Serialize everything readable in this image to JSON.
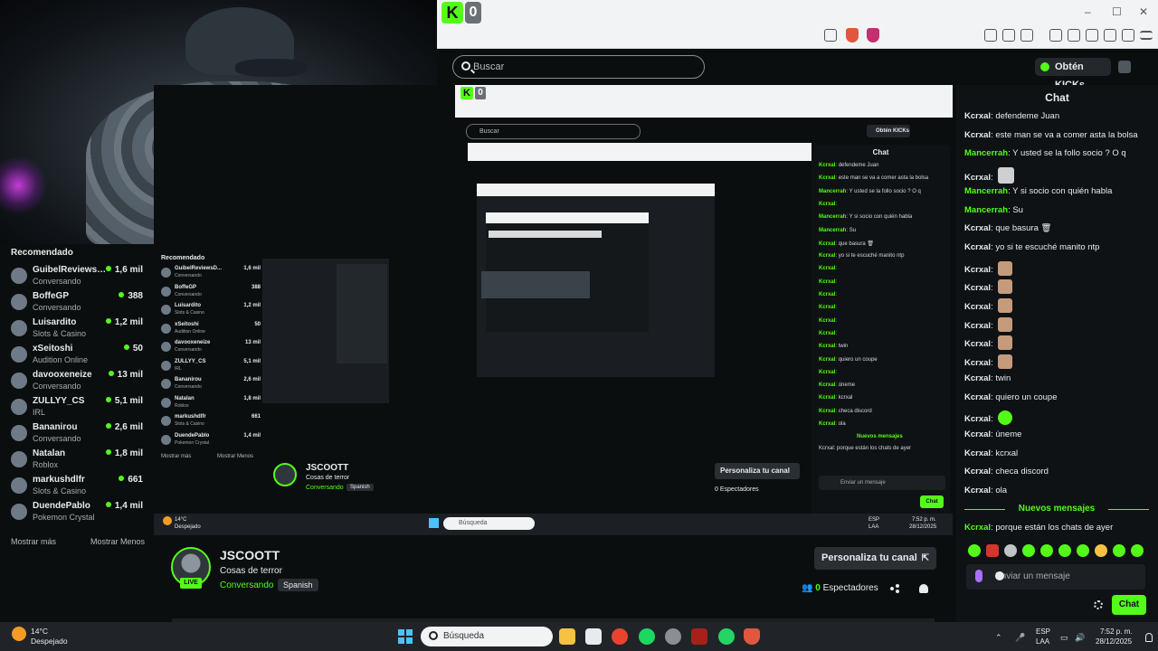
{
  "browser": {
    "kick_logo": "K",
    "badge": "0",
    "controls": [
      "–",
      "☐",
      "✕"
    ]
  },
  "header": {
    "search_placeholder": "Buscar",
    "kicks_button": "Obtén KICKs"
  },
  "sidebar": {
    "title": "Recomendado",
    "items": [
      {
        "name": "GuibelReviewsD...",
        "category": "Conversando",
        "viewers": "1,6 mil"
      },
      {
        "name": "BoffeGP",
        "category": "Conversando",
        "viewers": "388"
      },
      {
        "name": "Luisardito",
        "category": "Slots & Casino",
        "viewers": "1,2 mil"
      },
      {
        "name": "xSeitoshi",
        "category": "Audition Online",
        "viewers": "50"
      },
      {
        "name": "davooxeneize",
        "category": "Conversando",
        "viewers": "13 mil"
      },
      {
        "name": "ZULLYY_CS",
        "category": "IRL",
        "viewers": "5,1 mil"
      },
      {
        "name": "Bananirou",
        "category": "Conversando",
        "viewers": "2,6 mil"
      },
      {
        "name": "Natalan",
        "category": "Roblox",
        "viewers": "1,8 mil"
      },
      {
        "name": "markushdlfr",
        "category": "Slots & Casino",
        "viewers": "661"
      },
      {
        "name": "DuendePablo",
        "category": "Pokemon Crystal",
        "viewers": "1,4 mil"
      }
    ],
    "show_more": "Mostrar más",
    "show_less": "Mostrar Menos"
  },
  "chat": {
    "title": "Chat",
    "messages": [
      {
        "user": "Kcrxal",
        "text": "defendeme Juan",
        "emote": ""
      },
      {
        "user": "Kcrxal",
        "text": "este man se va a comer asta la bolsa",
        "emote": ""
      },
      {
        "user": "Mancerrah",
        "text": "Y usted se la follo socio ? O q",
        "emote": ""
      },
      {
        "user": "Kcrxal",
        "text": "",
        "emote": "pic"
      },
      {
        "user": "Mancerrah",
        "text": "Y si socio con quién habla",
        "emote": ""
      },
      {
        "user": "Mancerrah",
        "text": "Su",
        "emote": ""
      },
      {
        "user": "Kcrxal",
        "text": "que basura 🗑",
        "emote": ""
      },
      {
        "user": "Kcrxal",
        "text": "yo si te escuché manito ntp",
        "emote": ""
      },
      {
        "user": "Kcrxal",
        "text": "",
        "emote": "cat"
      },
      {
        "user": "Kcrxal",
        "text": "",
        "emote": "cat"
      },
      {
        "user": "Kcrxal",
        "text": "",
        "emote": "cat"
      },
      {
        "user": "Kcrxal",
        "text": "",
        "emote": "cat"
      },
      {
        "user": "Kcrxal",
        "text": "",
        "emote": "cat"
      },
      {
        "user": "Kcrxal",
        "text": "",
        "emote": "cat"
      },
      {
        "user": "Kcrxal",
        "text": "twin",
        "emote": ""
      },
      {
        "user": "Kcrxal",
        "text": "quiero un coupe",
        "emote": ""
      },
      {
        "user": "Kcrxal",
        "text": "",
        "emote": "green"
      },
      {
        "user": "Kcrxal",
        "text": "úneme",
        "emote": ""
      },
      {
        "user": "Kcrxal",
        "text": "kcrxal",
        "emote": ""
      },
      {
        "user": "Kcrxal",
        "text": "checa discord",
        "emote": ""
      },
      {
        "user": "Kcrxal",
        "text": "ola",
        "emote": ""
      }
    ],
    "new_messages": "Nuevos mensajes",
    "last_message": {
      "user": "Kcrxal",
      "text": "porque están los chats de ayer"
    },
    "input_placeholder": "Enviar un mensaje",
    "send_button": "Chat"
  },
  "streamer": {
    "name": "JSCOOTT",
    "title": "Cosas de terror",
    "category": "Conversando",
    "tag": "Spanish",
    "live": "LIVE",
    "customize_button": "Personaliza tu canal",
    "viewers_count": "0",
    "viewers_label": "Espectadores"
  },
  "nested": {
    "sidebar_title": "Recomendado",
    "chat_title": "Chat",
    "streamer_name": "JSCOOTT",
    "streamer_title": "Cosas de terror",
    "streamer_category": "Conversando",
    "streamer_tag": "Spanish",
    "customize_button": "Personaliza tu canal",
    "viewers_label": "0 Espectadores",
    "new_messages": "Nuevos mensajes",
    "last_message": "Kcrxal: porque están los chats de ayer",
    "input_placeholder": "Enviar un mensaje",
    "send_button": "Chat",
    "search_placeholder": "Buscar",
    "kicks_button": "Obtén KICKs",
    "kick_logo": "K",
    "badge": "0",
    "temp": "14°C",
    "condition": "Despejado",
    "taskbar_search": "Búsqueda",
    "lang1": "ESP",
    "lang2": "LAA",
    "clock_time": "7:52 p. m.",
    "clock_date": "28/12/2025",
    "show_more": "Mostrar más",
    "show_less": "Mostrar Menos"
  },
  "taskbar": {
    "temp": "14°C",
    "condition": "Despejado",
    "search_placeholder": "Búsqueda",
    "lang1": "ESP",
    "lang2": "LAA",
    "time": "7:52 p. m.",
    "date": "28/12/2025"
  },
  "colors": {
    "kick_green": "#53fc18",
    "background": "#0b0e0f",
    "panel": "#0f1214",
    "taskbar": "#202428"
  }
}
